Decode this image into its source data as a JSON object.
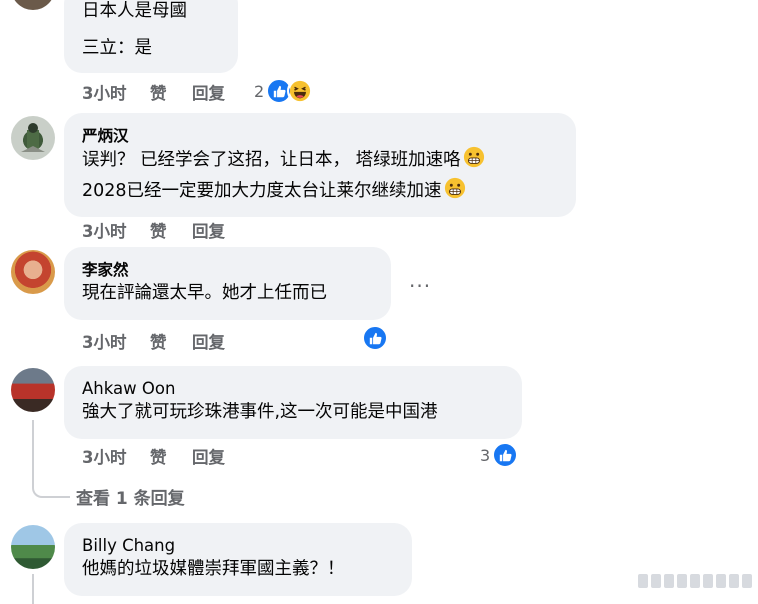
{
  "comments": [
    {
      "text_lines": [
        "日本人是母國",
        "三立：是"
      ],
      "time": "3小时",
      "like": "赞",
      "reply": "回复",
      "reaction_count": "2"
    },
    {
      "author": "严炳汉",
      "text_lines": [
        "误判？ 已经学会了这招，让日本， 塔绿班加速咯",
        "2028已经一定要加大力度太台让莱尔继续加速"
      ],
      "time": "3小时",
      "like": "赞",
      "reply": "回复"
    },
    {
      "author": "李家然",
      "text_lines": [
        "現在評論還太早。她才上任而已"
      ],
      "time": "3小时",
      "like": "赞",
      "reply": "回复",
      "more": "···"
    },
    {
      "author": "Ahkaw Oon",
      "text_lines": [
        "強大了就可玩珍珠港事件,这一次可能是中国港"
      ],
      "time": "3小时",
      "like": "赞",
      "reply": "回复",
      "reaction_count": "3",
      "view_replies": "查看 1 条回复"
    },
    {
      "author": "Billy Chang",
      "text_lines": [
        "他媽的垃圾媒體崇拜軍國主義？！"
      ]
    }
  ],
  "colors": {
    "bubble": "#f0f2f5",
    "meta": "#65676b",
    "like_blue": "#1877f2"
  }
}
